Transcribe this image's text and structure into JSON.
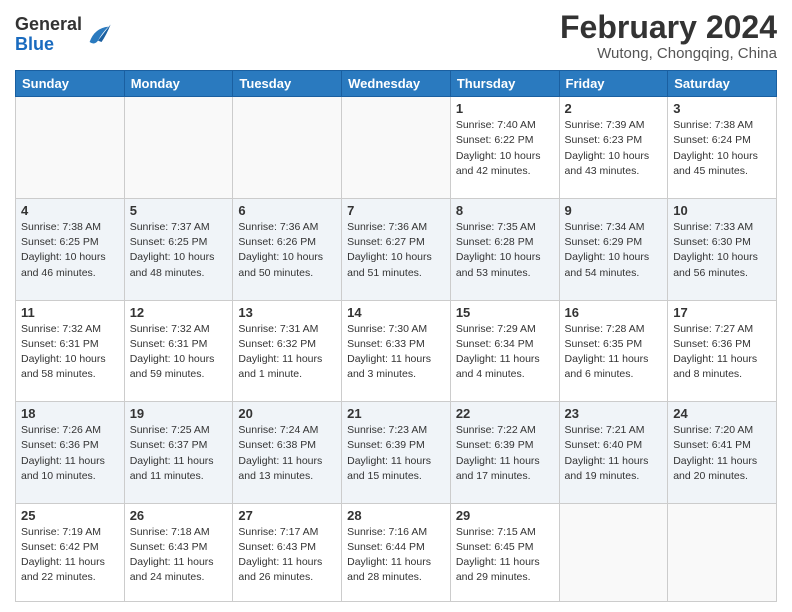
{
  "header": {
    "logo_general": "General",
    "logo_blue": "Blue",
    "title": "February 2024",
    "location": "Wutong, Chongqing, China"
  },
  "days_of_week": [
    "Sunday",
    "Monday",
    "Tuesday",
    "Wednesday",
    "Thursday",
    "Friday",
    "Saturday"
  ],
  "weeks": [
    [
      {
        "day": "",
        "info": ""
      },
      {
        "day": "",
        "info": ""
      },
      {
        "day": "",
        "info": ""
      },
      {
        "day": "",
        "info": ""
      },
      {
        "day": "1",
        "info": "Sunrise: 7:40 AM\nSunset: 6:22 PM\nDaylight: 10 hours\nand 42 minutes."
      },
      {
        "day": "2",
        "info": "Sunrise: 7:39 AM\nSunset: 6:23 PM\nDaylight: 10 hours\nand 43 minutes."
      },
      {
        "day": "3",
        "info": "Sunrise: 7:38 AM\nSunset: 6:24 PM\nDaylight: 10 hours\nand 45 minutes."
      }
    ],
    [
      {
        "day": "4",
        "info": "Sunrise: 7:38 AM\nSunset: 6:25 PM\nDaylight: 10 hours\nand 46 minutes."
      },
      {
        "day": "5",
        "info": "Sunrise: 7:37 AM\nSunset: 6:25 PM\nDaylight: 10 hours\nand 48 minutes."
      },
      {
        "day": "6",
        "info": "Sunrise: 7:36 AM\nSunset: 6:26 PM\nDaylight: 10 hours\nand 50 minutes."
      },
      {
        "day": "7",
        "info": "Sunrise: 7:36 AM\nSunset: 6:27 PM\nDaylight: 10 hours\nand 51 minutes."
      },
      {
        "day": "8",
        "info": "Sunrise: 7:35 AM\nSunset: 6:28 PM\nDaylight: 10 hours\nand 53 minutes."
      },
      {
        "day": "9",
        "info": "Sunrise: 7:34 AM\nSunset: 6:29 PM\nDaylight: 10 hours\nand 54 minutes."
      },
      {
        "day": "10",
        "info": "Sunrise: 7:33 AM\nSunset: 6:30 PM\nDaylight: 10 hours\nand 56 minutes."
      }
    ],
    [
      {
        "day": "11",
        "info": "Sunrise: 7:32 AM\nSunset: 6:31 PM\nDaylight: 10 hours\nand 58 minutes."
      },
      {
        "day": "12",
        "info": "Sunrise: 7:32 AM\nSunset: 6:31 PM\nDaylight: 10 hours\nand 59 minutes."
      },
      {
        "day": "13",
        "info": "Sunrise: 7:31 AM\nSunset: 6:32 PM\nDaylight: 11 hours\nand 1 minute."
      },
      {
        "day": "14",
        "info": "Sunrise: 7:30 AM\nSunset: 6:33 PM\nDaylight: 11 hours\nand 3 minutes."
      },
      {
        "day": "15",
        "info": "Sunrise: 7:29 AM\nSunset: 6:34 PM\nDaylight: 11 hours\nand 4 minutes."
      },
      {
        "day": "16",
        "info": "Sunrise: 7:28 AM\nSunset: 6:35 PM\nDaylight: 11 hours\nand 6 minutes."
      },
      {
        "day": "17",
        "info": "Sunrise: 7:27 AM\nSunset: 6:36 PM\nDaylight: 11 hours\nand 8 minutes."
      }
    ],
    [
      {
        "day": "18",
        "info": "Sunrise: 7:26 AM\nSunset: 6:36 PM\nDaylight: 11 hours\nand 10 minutes."
      },
      {
        "day": "19",
        "info": "Sunrise: 7:25 AM\nSunset: 6:37 PM\nDaylight: 11 hours\nand 11 minutes."
      },
      {
        "day": "20",
        "info": "Sunrise: 7:24 AM\nSunset: 6:38 PM\nDaylight: 11 hours\nand 13 minutes."
      },
      {
        "day": "21",
        "info": "Sunrise: 7:23 AM\nSunset: 6:39 PM\nDaylight: 11 hours\nand 15 minutes."
      },
      {
        "day": "22",
        "info": "Sunrise: 7:22 AM\nSunset: 6:39 PM\nDaylight: 11 hours\nand 17 minutes."
      },
      {
        "day": "23",
        "info": "Sunrise: 7:21 AM\nSunset: 6:40 PM\nDaylight: 11 hours\nand 19 minutes."
      },
      {
        "day": "24",
        "info": "Sunrise: 7:20 AM\nSunset: 6:41 PM\nDaylight: 11 hours\nand 20 minutes."
      }
    ],
    [
      {
        "day": "25",
        "info": "Sunrise: 7:19 AM\nSunset: 6:42 PM\nDaylight: 11 hours\nand 22 minutes."
      },
      {
        "day": "26",
        "info": "Sunrise: 7:18 AM\nSunset: 6:43 PM\nDaylight: 11 hours\nand 24 minutes."
      },
      {
        "day": "27",
        "info": "Sunrise: 7:17 AM\nSunset: 6:43 PM\nDaylight: 11 hours\nand 26 minutes."
      },
      {
        "day": "28",
        "info": "Sunrise: 7:16 AM\nSunset: 6:44 PM\nDaylight: 11 hours\nand 28 minutes."
      },
      {
        "day": "29",
        "info": "Sunrise: 7:15 AM\nSunset: 6:45 PM\nDaylight: 11 hours\nand 29 minutes."
      },
      {
        "day": "",
        "info": ""
      },
      {
        "day": "",
        "info": ""
      }
    ]
  ]
}
